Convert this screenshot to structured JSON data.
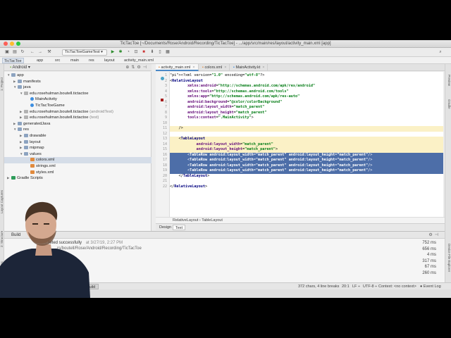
{
  "window": {
    "title": "TicTacToe [~/Documents/Rose/Android/Recording/TicTacToe] - .../app/src/main/res/layout/activity_main.xml [app]"
  },
  "toolbar": {
    "run_config": "TicTacToeGameTest"
  },
  "breadcrumbs": [
    "TicTacToe",
    "app",
    "src",
    "main",
    "res",
    "layout",
    "activity_main.xml"
  ],
  "project_panel": {
    "view_label": "Android",
    "tree": [
      {
        "label": "app",
        "depth": 0,
        "icon": "folder-icon",
        "expanded": true
      },
      {
        "label": "manifests",
        "depth": 1,
        "icon": "folder-icon",
        "expanded": false
      },
      {
        "label": "java",
        "depth": 1,
        "icon": "folder-icon",
        "expanded": true
      },
      {
        "label": "edu.rosehulman.boutell.tictactoe",
        "depth": 2,
        "icon": "package-icon",
        "expanded": true
      },
      {
        "label": "MainActivity",
        "depth": 3,
        "icon": "class-icon"
      },
      {
        "label": "TicTacToeGame",
        "depth": 3,
        "icon": "class-icon"
      },
      {
        "label": "edu.rosehulman.boutell.tictactoe",
        "suffix": "(androidTest)",
        "depth": 2,
        "icon": "package-icon",
        "expanded": false
      },
      {
        "label": "edu.rosehulman.boutell.tictactoe",
        "suffix": "(test)",
        "depth": 2,
        "icon": "package-icon",
        "expanded": false
      },
      {
        "label": "generatedJava",
        "depth": 1,
        "icon": "folder-icon",
        "expanded": false
      },
      {
        "label": "res",
        "depth": 1,
        "icon": "folder-icon",
        "expanded": true
      },
      {
        "label": "drawable",
        "depth": 2,
        "icon": "folder-icon",
        "expanded": false
      },
      {
        "label": "layout",
        "depth": 2,
        "icon": "folder-icon",
        "expanded": false
      },
      {
        "label": "mipmap",
        "depth": 2,
        "icon": "folder-icon",
        "expanded": false
      },
      {
        "label": "values",
        "depth": 2,
        "icon": "folder-icon",
        "expanded": true
      },
      {
        "label": "colors.xml",
        "depth": 3,
        "icon": "xml-icon",
        "selected": true
      },
      {
        "label": "strings.xml",
        "depth": 3,
        "icon": "xml-icon"
      },
      {
        "label": "styles.xml",
        "depth": 3,
        "icon": "xml-icon"
      },
      {
        "label": "Gradle Scripts",
        "depth": 0,
        "icon": "gradle-icon",
        "expanded": false
      }
    ]
  },
  "left_strip_tabs": [
    "1: Project",
    "Layout Captures",
    "2: Structure",
    "Z: Favorites",
    "Build Variants"
  ],
  "right_strip_tabs": [
    "Preview",
    "Gradle",
    "Device File Explorer"
  ],
  "editor_tabs": [
    {
      "label": "activity_main.xml",
      "active": true
    },
    {
      "label": "colors.xml",
      "active": false
    },
    {
      "label": "MainActivity.kt",
      "active": false
    }
  ],
  "code_lines": [
    {
      "n": "1",
      "text": "<?xml version=\"1.0\" encoding=\"utf-8\"?>",
      "hl": ""
    },
    {
      "n": "2",
      "text": "<RelativeLayout",
      "hl": ""
    },
    {
      "n": "3",
      "text": "        xmlns:android=\"http://schemas.android.com/apk/res/android\"",
      "hl": ""
    },
    {
      "n": "4",
      "text": "        xmlns:tools=\"http://schemas.android.com/tools\"",
      "hl": ""
    },
    {
      "n": "5",
      "text": "        xmlns:app=\"http://schemas.android.com/apk/res-auto\"",
      "hl": ""
    },
    {
      "n": "6",
      "text": "        android:background=\"@color/colorBackground\"",
      "hl": ""
    },
    {
      "n": "7",
      "text": "        android:layout_width=\"match_parent\"",
      "hl": ""
    },
    {
      "n": "8",
      "text": "        android:layout_height=\"match_parent\"",
      "hl": ""
    },
    {
      "n": "9",
      "text": "        tools:context=\".MainActivity\">",
      "hl": ""
    },
    {
      "n": "10",
      "text": "",
      "hl": ""
    },
    {
      "n": "11",
      "text": "    />",
      "hl": "yellow"
    },
    {
      "n": "12",
      "text": "",
      "hl": ""
    },
    {
      "n": "13",
      "text": "    <TableLayout",
      "hl": "yellow"
    },
    {
      "n": "14",
      "text": "            android:layout_width=\"match_parent\"",
      "hl": "yellow"
    },
    {
      "n": "15",
      "text": "            android:layout_height=\"match_parent\">",
      "hl": "yellow"
    },
    {
      "n": "16",
      "text": "        <TableRow android:layout_width=\"match_parent\" android:layout_height=\"match_parent\"/>",
      "hl": "blue"
    },
    {
      "n": "17",
      "text": "        <TableRow android:layout_width=\"match_parent\" android:layout_height=\"match_parent\"/>",
      "hl": "blue"
    },
    {
      "n": "18",
      "text": "        <TableRow android:layout_width=\"match_parent\" android:layout_height=\"match_parent\"/>",
      "hl": "blue"
    },
    {
      "n": "19",
      "text": "        <TableRow android:layout_width=\"match_parent\" android:layout_height=\"match_parent\"/>",
      "hl": "blue"
    },
    {
      "n": "20",
      "text": "    </TableLayout>",
      "hl": ""
    },
    {
      "n": "21",
      "text": "",
      "hl": ""
    },
    {
      "n": "22",
      "text": "</RelativeLayout>",
      "hl": ""
    }
  ],
  "editor_breadcrumb": [
    "RelativeLayout",
    "TableLayout"
  ],
  "design_tabs": [
    {
      "label": "Design",
      "active": false
    },
    {
      "label": "Text",
      "active": true
    }
  ],
  "build": {
    "header": "Build",
    "message": "...leted successfully",
    "timestamp": "at 3/27/19, 2:27 PM",
    "path": "...rs/boutell/Rose/Android/Recording/TicTacToe",
    "times": [
      "752 ms",
      "656 ms",
      "4 ms",
      "317 ms",
      "67 ms",
      "260 ms"
    ]
  },
  "statusbar": {
    "build_tab": "Build",
    "position": "372 chars, 4 line breaks",
    "line_col": "20:1",
    "line_sep": "LF ÷",
    "encoding": "UTF-8 ÷",
    "context": "Context: <no context>",
    "event_log": "Event Log"
  },
  "colors": {
    "selection_blue": "#4d6ea8",
    "highlight_yellow": "#fbf1c6",
    "tag_blue": "#00007f",
    "string_green": "#067d17",
    "attr_purple": "#660e7a"
  }
}
